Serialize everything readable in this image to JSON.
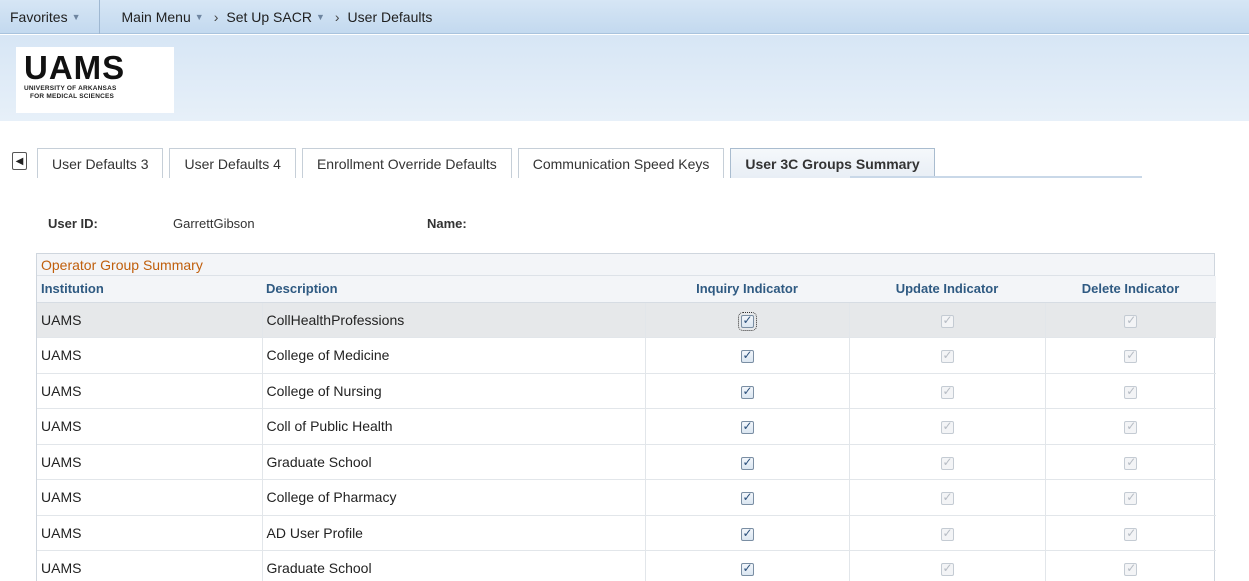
{
  "nav": {
    "favorites": "Favorites",
    "main_menu": "Main Menu",
    "crumb_1": "Set Up SACR",
    "crumb_2": "User Defaults"
  },
  "logo": {
    "name": "UAMS",
    "line1": "UNIVERSITY OF ARKANSAS",
    "line2": "FOR MEDICAL SCIENCES"
  },
  "tabs": [
    {
      "label": "User Defaults 3",
      "active": false
    },
    {
      "label": "User Defaults 4",
      "active": false
    },
    {
      "label": "Enrollment Override Defaults",
      "active": false
    },
    {
      "label": "Communication Speed Keys",
      "active": false
    },
    {
      "label": "User 3C Groups Summary",
      "active": true
    }
  ],
  "user": {
    "id_label": "User ID:",
    "id_value": "GarrettGibson",
    "name_label": "Name:"
  },
  "grid": {
    "title": "Operator Group Summary",
    "columns": [
      "Institution",
      "Description",
      "Inquiry Indicator",
      "Update Indicator",
      "Delete Indicator"
    ],
    "rows": [
      {
        "institution": "UAMS",
        "description": "CollHealthProfessions"
      },
      {
        "institution": "UAMS",
        "description": "College of Medicine"
      },
      {
        "institution": "UAMS",
        "description": "College of Nursing"
      },
      {
        "institution": "UAMS",
        "description": "Coll of Public Health"
      },
      {
        "institution": "UAMS",
        "description": "Graduate School"
      },
      {
        "institution": "UAMS",
        "description": "College of Pharmacy"
      },
      {
        "institution": "UAMS",
        "description": "AD User Profile"
      },
      {
        "institution": "UAMS",
        "description": "Graduate School"
      }
    ]
  },
  "colors": {
    "accent_orange": "#c05f0c",
    "header_blue": "#2f5a82",
    "nav_bg": "#c3d9ef"
  }
}
